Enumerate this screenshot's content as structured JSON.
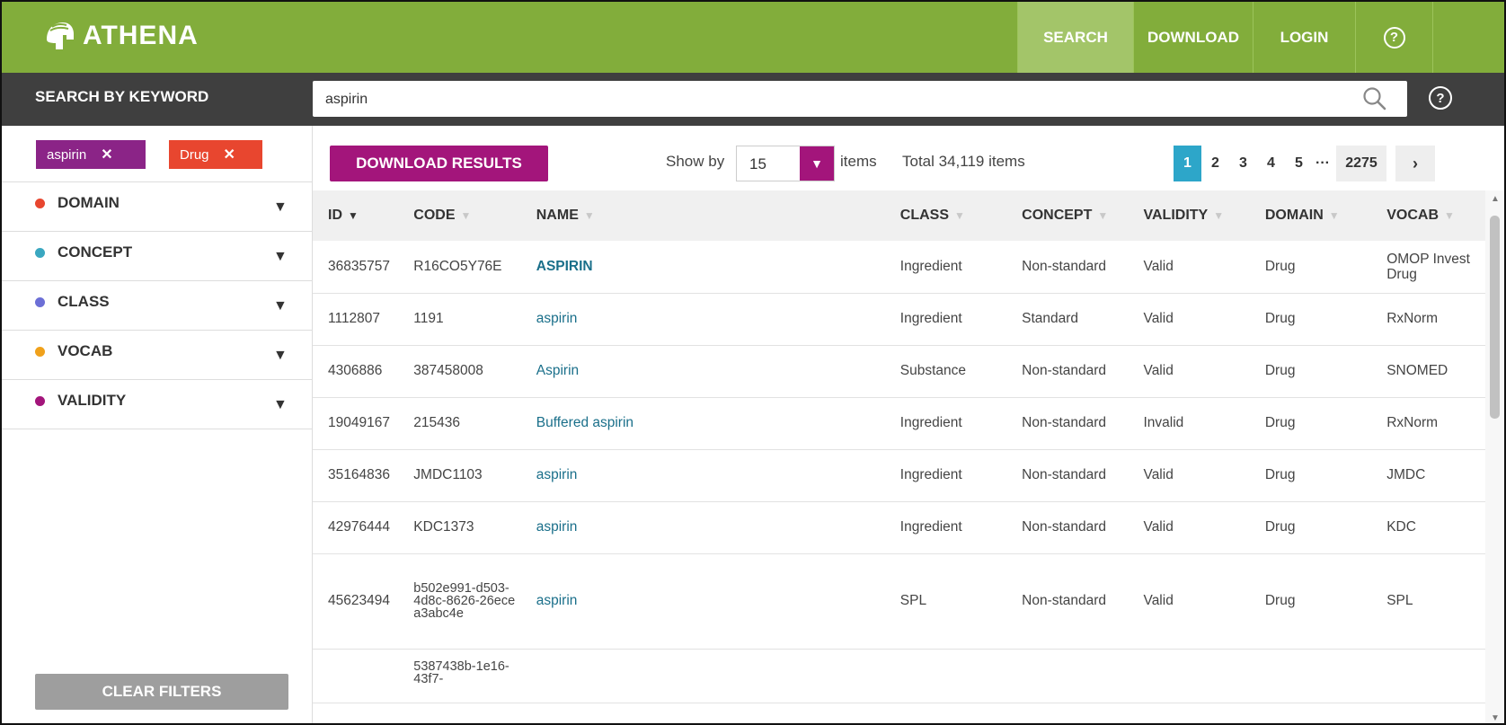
{
  "app": {
    "logo_text": "ATHENA"
  },
  "nav": {
    "search": "SEARCH",
    "download": "DOWNLOAD",
    "login": "LOGIN",
    "help": "?"
  },
  "search": {
    "label": "SEARCH BY KEYWORD",
    "value": "aspirin",
    "help": "?"
  },
  "filters": {
    "chips": [
      {
        "label": "aspirin",
        "color": "#8b2487"
      },
      {
        "label": "Drug",
        "color": "#e8462f"
      }
    ],
    "facets": [
      {
        "label": "DOMAIN",
        "color": "#e8462f"
      },
      {
        "label": "CONCEPT",
        "color": "#3aa7c0"
      },
      {
        "label": "CLASS",
        "color": "#6c6fd6"
      },
      {
        "label": "VOCAB",
        "color": "#f0a11b"
      },
      {
        "label": "VALIDITY",
        "color": "#a3157b"
      }
    ],
    "clear_label": "CLEAR FILTERS"
  },
  "toolbar": {
    "download_label": "DOWNLOAD RESULTS",
    "show_by_label": "Show by",
    "show_by_value": "15",
    "items_label": "items",
    "total_label": "Total 34,119 items"
  },
  "pagination": {
    "pages": [
      "1",
      "2",
      "3",
      "4",
      "5"
    ],
    "current": "1",
    "ellipsis": "···",
    "last": "2275",
    "next": "›"
  },
  "table": {
    "columns": [
      "ID",
      "CODE",
      "NAME",
      "CLASS",
      "CONCEPT",
      "VALIDITY",
      "DOMAIN",
      "VOCAB"
    ],
    "rows": [
      {
        "id": "36835757",
        "code": "R16CO5Y76E",
        "name": "ASPIRIN",
        "class": "Ingredient",
        "concept": "Non-standard",
        "validity": "Valid",
        "domain": "Drug",
        "vocab": "OMOP Invest Drug"
      },
      {
        "id": "1112807",
        "code": "1191",
        "name": "aspirin",
        "class": "Ingredient",
        "concept": "Standard",
        "validity": "Valid",
        "domain": "Drug",
        "vocab": "RxNorm"
      },
      {
        "id": "4306886",
        "code": "387458008",
        "name": "Aspirin",
        "class": "Substance",
        "concept": "Non-standard",
        "validity": "Valid",
        "domain": "Drug",
        "vocab": "SNOMED"
      },
      {
        "id": "19049167",
        "code": "215436",
        "name": "Buffered aspirin",
        "class": "Ingredient",
        "concept": "Non-standard",
        "validity": "Invalid",
        "domain": "Drug",
        "vocab": "RxNorm"
      },
      {
        "id": "35164836",
        "code": "JMDC1103",
        "name": "aspirin",
        "class": "Ingredient",
        "concept": "Non-standard",
        "validity": "Valid",
        "domain": "Drug",
        "vocab": "JMDC"
      },
      {
        "id": "42976444",
        "code": "KDC1373",
        "name": "aspirin",
        "class": "Ingredient",
        "concept": "Non-standard",
        "validity": "Valid",
        "domain": "Drug",
        "vocab": "KDC"
      },
      {
        "id": "45623494",
        "code": "b502e991-d503-4d8c-8626-26ecea3abc4e",
        "name": "aspirin",
        "class": "SPL",
        "concept": "Non-standard",
        "validity": "Valid",
        "domain": "Drug",
        "vocab": "SPL"
      },
      {
        "id": "",
        "code": "5387438b-1e16-43f7-",
        "name": "",
        "class": "",
        "concept": "",
        "validity": "",
        "domain": "",
        "vocab": ""
      }
    ]
  }
}
